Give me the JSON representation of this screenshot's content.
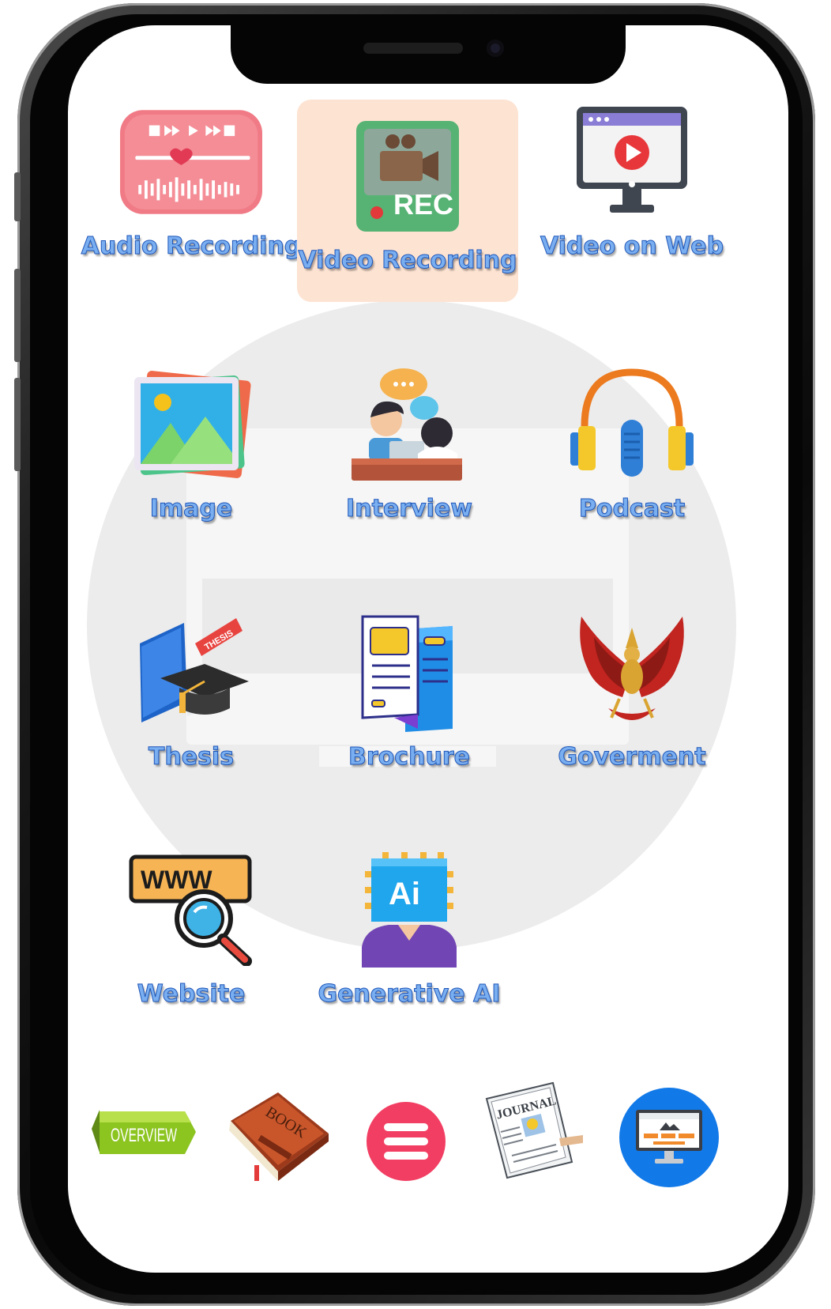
{
  "grid": [
    {
      "label": "Audio Recording",
      "icon": "audio-waveform-icon",
      "active": false
    },
    {
      "label": "Video Recording",
      "icon": "video-camera-rec-icon",
      "active": true,
      "badge": "REC"
    },
    {
      "label": "Video on Web",
      "icon": "web-video-monitor-icon",
      "active": false
    },
    {
      "label": "Image",
      "icon": "image-landscape-icon",
      "active": false
    },
    {
      "label": "Interview",
      "icon": "interview-people-icon",
      "active": false
    },
    {
      "label": "Podcast",
      "icon": "podcast-headphones-icon",
      "active": false
    },
    {
      "label": "Thesis",
      "icon": "thesis-book-cap-icon",
      "active": false,
      "tag": "THESIS"
    },
    {
      "label": "Brochure",
      "icon": "brochure-icon",
      "active": false
    },
    {
      "label": "Goverment",
      "icon": "garuda-emblem-icon",
      "active": false
    },
    {
      "label": "Website",
      "icon": "www-search-icon",
      "active": false,
      "tag": "WWW"
    },
    {
      "label": "Generative AI",
      "icon": "ai-chip-person-icon",
      "active": false,
      "tag": "Ai"
    }
  ],
  "dock": {
    "overview_label": "OVERVIEW",
    "book_label": "BOOK",
    "journal_label": "JOURNAL"
  },
  "colors": {
    "label_fill": "#79aef0",
    "label_stroke": "#1f56b8",
    "active_tile": "#fde3d2",
    "menu_button": "#f23e62",
    "monitor_button": "#1279e8"
  }
}
